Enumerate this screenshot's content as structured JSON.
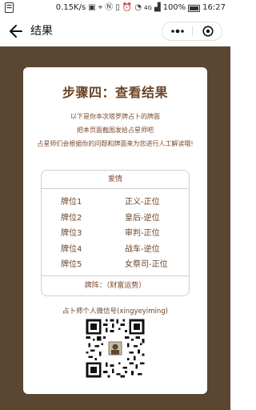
{
  "status_bar": {
    "speed": "0.15K/s",
    "network": "4G",
    "battery": "100%",
    "time": "16:27"
  },
  "nav": {
    "title": "结果"
  },
  "card": {
    "step_title": "步骤四：查看结果",
    "desc_line1": "以下是你本次塔罗牌占卜的牌面",
    "desc_line2": "把本页面截图发给占星师吧",
    "desc_line3": "占星师们会根据你的问题和牌面来为您进行人工解读哦!",
    "table": {
      "header": "爱情",
      "rows": [
        {
          "position": "牌位1",
          "card": "正义-正位"
        },
        {
          "position": "牌位2",
          "card": "皇后-逆位"
        },
        {
          "position": "牌位3",
          "card": "审判-正位"
        },
        {
          "position": "牌位4",
          "card": "战车-逆位"
        },
        {
          "position": "牌位5",
          "card": "女祭司-正位"
        }
      ],
      "footer": "牌阵：（财富运势）"
    },
    "wechat_label": "占卜师个人微信号(xingyeyiming)"
  },
  "colors": {
    "background": "#5a4631",
    "accent_text": "#6b4527"
  }
}
